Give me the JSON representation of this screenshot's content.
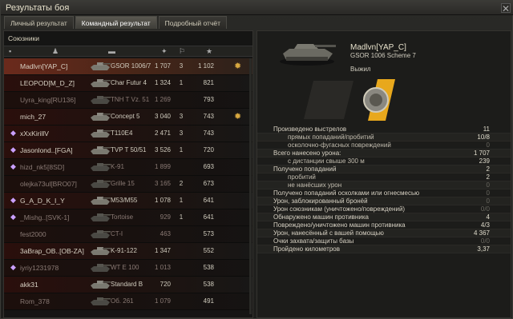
{
  "window": {
    "title": "Результаты боя",
    "close_icon": "close-icon"
  },
  "tabs": [
    {
      "label": "Личный результат",
      "active": false
    },
    {
      "label": "Командный результат",
      "active": true
    },
    {
      "label": "Подробный отчёт",
      "active": false
    }
  ],
  "left": {
    "section_title": "Союзники",
    "header_icons": [
      "squad-icon",
      "player-icon",
      "tank-icon",
      "damage-icon",
      "kills-icon",
      "xp-star-icon"
    ],
    "players": [
      {
        "name": "Madlvn[YAP_C]",
        "tank": "GSOR 1006/7",
        "damage": "1 707",
        "kills": "3",
        "xp": "1 102",
        "alive": true,
        "player": true,
        "medal": true,
        "platoon": false
      },
      {
        "name": "LEOPOD[M_D_Z]",
        "tank": "Char Futur 4",
        "damage": "1 324",
        "kills": "1",
        "xp": "821",
        "alive": true,
        "player": false,
        "medal": false,
        "platoon": false
      },
      {
        "name": "Uyra_king[RU136]",
        "tank": "TNH T Vz. 51",
        "damage": "1 269",
        "kills": "",
        "xp": "793",
        "alive": false,
        "player": false,
        "medal": false,
        "platoon": false
      },
      {
        "name": "mich_27",
        "tank": "Concept 5",
        "damage": "3 040",
        "kills": "3",
        "xp": "743",
        "alive": true,
        "player": false,
        "medal": true,
        "platoon": false
      },
      {
        "name": "xXxKirillV",
        "tank": "T110E4",
        "damage": "2 471",
        "kills": "3",
        "xp": "743",
        "alive": true,
        "player": false,
        "medal": false,
        "platoon": true
      },
      {
        "name": "Jasonlond..[FGA]",
        "tank": "TVP T 50/51",
        "damage": "3 526",
        "kills": "1",
        "xp": "720",
        "alive": true,
        "player": false,
        "medal": false,
        "platoon": true
      },
      {
        "name": "hizd_nk5[8SD]",
        "tank": "K-91",
        "damage": "1 899",
        "kills": "",
        "xp": "693",
        "alive": false,
        "player": false,
        "medal": false,
        "platoon": true
      },
      {
        "name": "olejka73ul[BRO07]",
        "tank": "Grille 15",
        "damage": "3 165",
        "kills": "2",
        "xp": "673",
        "alive": false,
        "player": false,
        "medal": false,
        "platoon": false
      },
      {
        "name": "G_A_D_K_I_Y",
        "tank": "M53/M55",
        "damage": "1 078",
        "kills": "1",
        "xp": "641",
        "alive": true,
        "player": false,
        "medal": false,
        "platoon": true
      },
      {
        "name": "_Mishg..[SVK-1]",
        "tank": "Tortoise",
        "damage": "929",
        "kills": "1",
        "xp": "641",
        "alive": false,
        "player": false,
        "medal": false,
        "platoon": true
      },
      {
        "name": "fest2000",
        "tank": "CT-I",
        "damage": "463",
        "kills": "",
        "xp": "573",
        "alive": false,
        "player": false,
        "medal": false,
        "platoon": false
      },
      {
        "name": "3aBrap_OB..[OB-ZA]",
        "tank": "K-91-122",
        "damage": "1 347",
        "kills": "",
        "xp": "552",
        "alive": true,
        "player": false,
        "medal": false,
        "platoon": false
      },
      {
        "name": "iyriy1231978",
        "tank": "WT E 100",
        "damage": "1 013",
        "kills": "",
        "xp": "538",
        "alive": false,
        "player": false,
        "medal": false,
        "platoon": true
      },
      {
        "name": "akk31",
        "tank": "Standard B",
        "damage": "720",
        "kills": "",
        "xp": "538",
        "alive": true,
        "player": false,
        "medal": false,
        "platoon": false
      },
      {
        "name": "Rom_378",
        "tank": "Об. 261",
        "damage": "1 079",
        "kills": "",
        "xp": "491",
        "alive": false,
        "player": false,
        "medal": false,
        "platoon": false
      }
    ]
  },
  "right": {
    "player_name": "Madlvn[YAP_C]",
    "tank_name": "GSOR 1006 Scheme 7",
    "status": "Выжил",
    "stats": [
      {
        "label": "Произведено выстрелов",
        "value": "11",
        "sub": false,
        "dim": false
      },
      {
        "label": "прямых попаданий/пробитий",
        "value": "10/8",
        "sub": true,
        "dim": false
      },
      {
        "label": "осколочно-фугасных повреждений",
        "value": "0",
        "sub": true,
        "dim": true
      },
      {
        "label": "Всего нанесено урона:",
        "value": "1 707",
        "sub": false,
        "dim": false
      },
      {
        "label": "с дистанции свыше 300 м",
        "value": "239",
        "sub": true,
        "dim": false
      },
      {
        "label": "Получено попаданий",
        "value": "2",
        "sub": false,
        "dim": false
      },
      {
        "label": "пробитий",
        "value": "2",
        "sub": true,
        "dim": false
      },
      {
        "label": "не нанёсших урон",
        "value": "0",
        "sub": true,
        "dim": true
      },
      {
        "label": "Получено попаданий осколками или огнесмесью",
        "value": "0",
        "sub": false,
        "dim": true
      },
      {
        "label": "Урон, заблокированный бронёй",
        "value": "0",
        "sub": false,
        "dim": true
      },
      {
        "label": "Урон союзникам (уничтожено/повреждений)",
        "value": "0/0",
        "sub": false,
        "dim": true
      },
      {
        "label": "Обнаружено машин противника",
        "value": "4",
        "sub": false,
        "dim": false
      },
      {
        "label": "Повреждено/уничтожено машин противника",
        "value": "4/3",
        "sub": false,
        "dim": false
      },
      {
        "label": "Урон, нанесённый с вашей помощью",
        "value": "4 367",
        "sub": false,
        "dim": false
      },
      {
        "label": "Очки захвата/защиты базы",
        "value": "0/0",
        "sub": false,
        "dim": true
      },
      {
        "label": "Пройдено километров",
        "value": "3,37",
        "sub": false,
        "dim": false
      }
    ]
  },
  "colors": {
    "player_row": "#6b2a1c",
    "banner_yellow": "#e8a81c",
    "medal": "#d8a840"
  }
}
